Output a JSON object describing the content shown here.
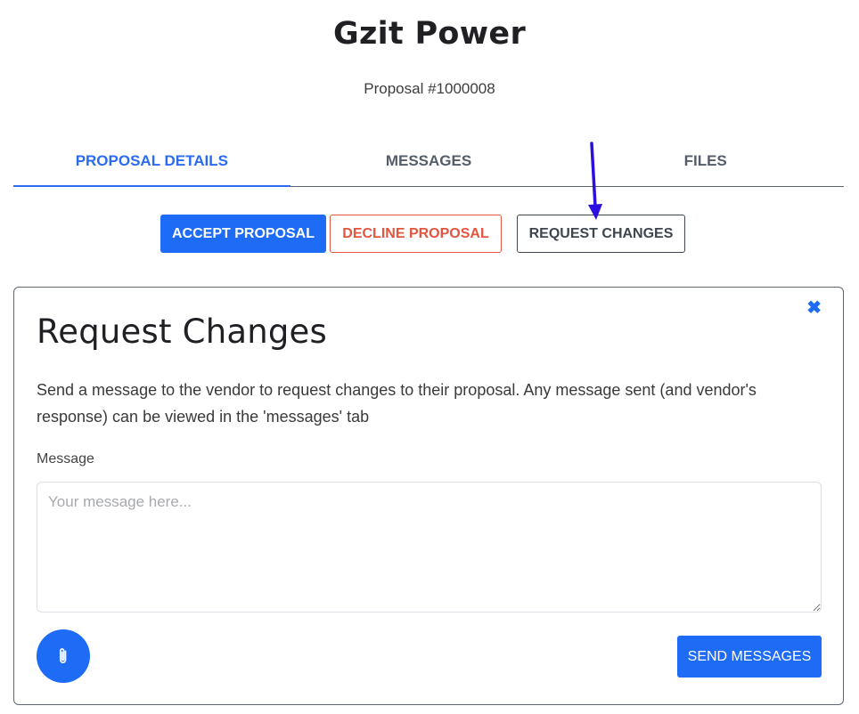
{
  "header": {
    "company": "Gzit Power",
    "proposal_number": "Proposal #1000008"
  },
  "tabs": [
    {
      "label": "PROPOSAL DETAILS",
      "active": true
    },
    {
      "label": "MESSAGES",
      "active": false
    },
    {
      "label": "FILES",
      "active": false
    }
  ],
  "actions": {
    "accept": "ACCEPT PROPOSAL",
    "decline": "DECLINE PROPOSAL",
    "request": "REQUEST CHANGES"
  },
  "panel": {
    "title": "Request Changes",
    "description": "Send a message to the vendor to request changes to their proposal. Any message sent (and vendor's response) can be viewed in the 'messages' tab",
    "message_label": "Message",
    "message_placeholder": "Your message here...",
    "message_value": "",
    "close_glyph": "✖",
    "send_label": "SEND MESSAGES"
  },
  "icons": {
    "close": "close-icon",
    "attach": "paperclip-icon",
    "arrow": "arrow-down-icon"
  },
  "colors": {
    "primary": "#1e6bf5",
    "danger": "#e2553f",
    "arrow": "#2a0fe0"
  }
}
